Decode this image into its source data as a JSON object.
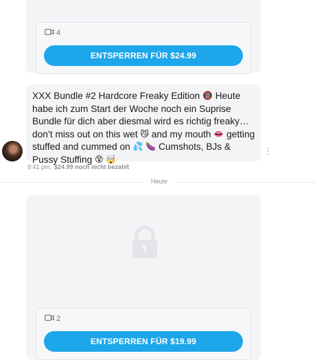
{
  "colors": {
    "accent": "#1da6ea",
    "bubble_bg": "#f3f4f6",
    "muted_text": "#8a8f95"
  },
  "locked_post_top": {
    "media_icon": "video-icon",
    "media_count": "4",
    "unlock_label": "ENTSPERREN FÜR $24.99"
  },
  "message": {
    "parts": [
      "XXX Bundle #2 Hardcore Freaky Edition ",
      "🔞",
      " Heute habe ich zum Start der Woche noch ein Suprise Bundle für dich aber diesmal wird es richtig freaky…don’t miss out on this wet ",
      "😼",
      " and my mouth ",
      "👄",
      " getting stuffed and cummed on ",
      "💦",
      " ",
      "🍆",
      " Cumshots, BJs & Pussy Stuffing ",
      "😵",
      " ",
      "🤯"
    ],
    "time": "9:41 pm,",
    "price_status": "$24.99 noch nicht bezahlt",
    "more_icon": "more-vertical-icon",
    "avatar_icon": "avatar-image"
  },
  "separator": {
    "label": "Heute"
  },
  "locked_post_bottom": {
    "lock_icon": "lock-icon",
    "media_icon": "video-icon",
    "media_count": "2",
    "unlock_label": "ENTSPERREN FÜR $19.99"
  }
}
